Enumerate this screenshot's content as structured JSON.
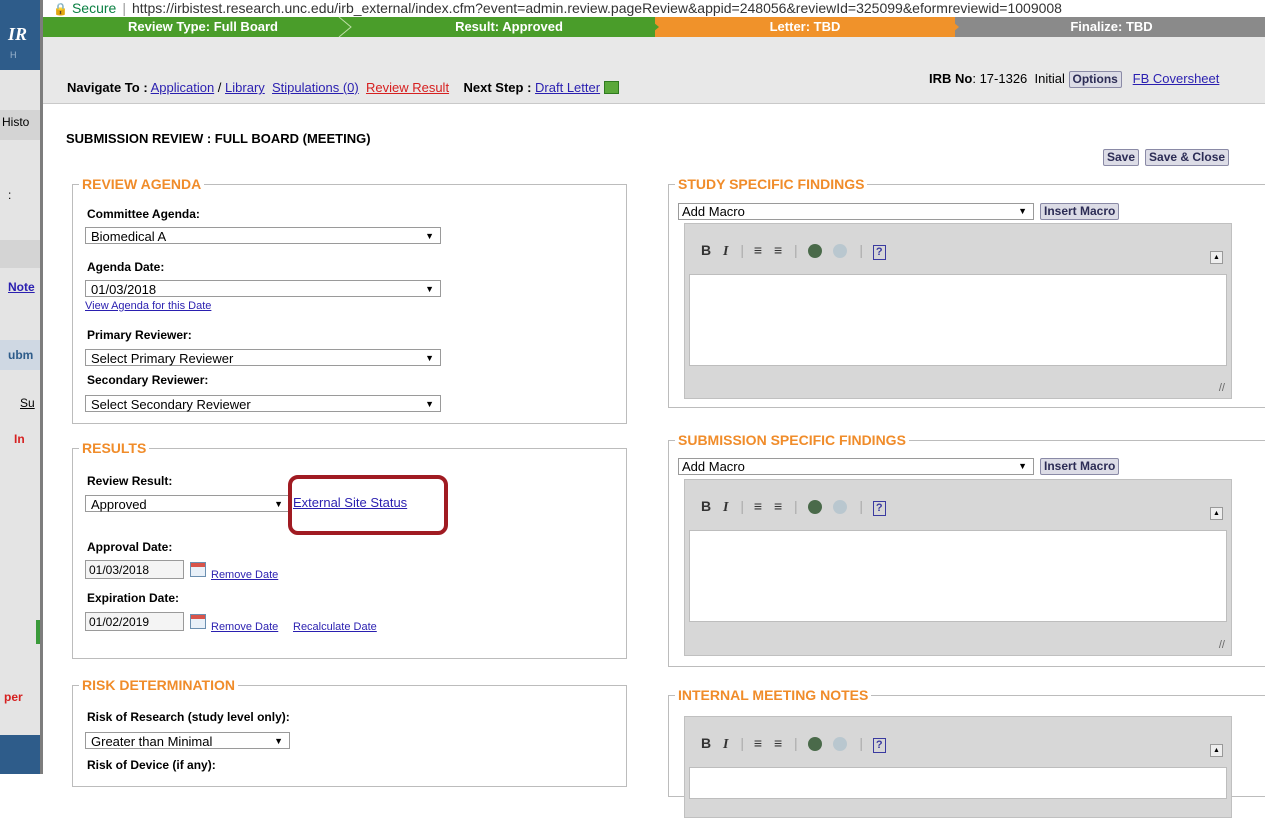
{
  "background_app": {
    "logo": "IR",
    "home_text": "H",
    "sidebar_fragments": [
      "Histo",
      ":",
      "Note",
      "ubm",
      "Su",
      "In",
      "per"
    ]
  },
  "browser": {
    "secure_label": "Secure",
    "url": "https://irbistest.research.unc.edu/irb_external/index.cfm?event=admin.review.pageReview&appid=248056&reviewId=325099&eformreviewid=1009008"
  },
  "workflow": [
    {
      "label": "Review Type: Full Board",
      "color": "#4a9d2a"
    },
    {
      "label": "Result: Approved",
      "color": "#4a9d2a"
    },
    {
      "label": "Letter: TBD",
      "color": "#f0922a"
    },
    {
      "label": "Finalize: TBD",
      "color": "#8a8a8a"
    }
  ],
  "nav": {
    "navigate_to_label": "Navigate To :",
    "application_link": "Application",
    "slash": " / ",
    "library_link": "Library",
    "stipulations_link": "Stipulations (0)",
    "review_result_link": "Review Result",
    "next_step_label": "Next Step :",
    "draft_letter_link": "Draft Letter",
    "irb_no_label": "IRB No",
    "irb_no_value": ": 17-1326",
    "status": "Initial",
    "options_button": "Options",
    "coversheet_link": "FB Coversheet"
  },
  "page": {
    "title": "SUBMISSION REVIEW : FULL BOARD (MEETING)",
    "save_button": "Save",
    "save_close_button": "Save & Close"
  },
  "review_agenda": {
    "legend": "REVIEW AGENDA",
    "committee_label": "Committee Agenda:",
    "committee_value": "Biomedical A",
    "agenda_date_label": "Agenda Date:",
    "agenda_date_value": "01/03/2018",
    "view_agenda_link": "View Agenda for this Date",
    "primary_label": "Primary Reviewer:",
    "primary_value": "Select Primary Reviewer",
    "secondary_label": "Secondary Reviewer:",
    "secondary_value": "Select Secondary Reviewer"
  },
  "results": {
    "legend": "RESULTS",
    "review_result_label": "Review Result:",
    "review_result_value": "Approved",
    "external_site_link": "External Site Status",
    "approval_date_label": "Approval Date:",
    "approval_date_value": "01/03/2018",
    "remove_date_link": "Remove Date",
    "expiration_date_label": "Expiration Date:",
    "expiration_date_value": "01/02/2019",
    "remove_date_link2": "Remove Date",
    "recalculate_link": "Recalculate Date"
  },
  "risk": {
    "legend": "RISK DETERMINATION",
    "research_label": "Risk of Research (study level only):",
    "research_value": "Greater than Minimal",
    "device_label": "Risk of Device (if any):"
  },
  "study_findings": {
    "legend": "STUDY SPECIFIC FINDINGS",
    "macro_value": "Add Macro",
    "insert_button": "Insert Macro"
  },
  "submission_findings": {
    "legend": "SUBMISSION SPECIFIC FINDINGS",
    "macro_value": "Add Macro",
    "insert_button": "Insert Macro"
  },
  "meeting_notes": {
    "legend": "INTERNAL MEETING NOTES"
  },
  "editor_toolbar": {
    "bold": "B",
    "italic": "I",
    "help": "?"
  }
}
